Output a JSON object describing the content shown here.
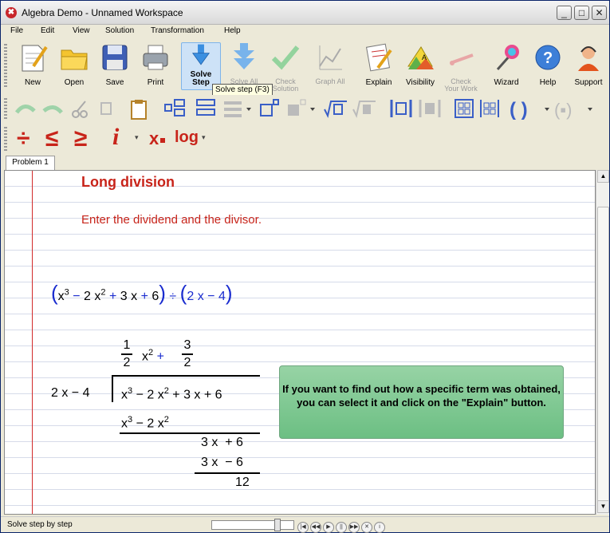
{
  "window": {
    "title": "Algebra Demo - Unnamed Workspace",
    "controls": {
      "minimize": "_",
      "maximize": "□",
      "close": "✕"
    }
  },
  "menu": [
    "File",
    "Edit",
    "View",
    "Solution",
    "Transformation",
    "Help"
  ],
  "toolbar_main": [
    {
      "label": "New",
      "icon": "new-document-icon"
    },
    {
      "label": "Open",
      "icon": "folder-icon"
    },
    {
      "label": "Save",
      "icon": "floppy-icon"
    },
    {
      "label": "Print",
      "icon": "printer-icon"
    },
    {
      "label": "Solve Step",
      "icon": "down-arrow-icon"
    },
    {
      "label": "Solve All",
      "icon": "double-down-arrow-icon"
    },
    {
      "label": "Check Solution",
      "icon": "checkmark-icon"
    },
    {
      "label": "Graph All",
      "icon": "graph-icon"
    },
    {
      "label": "Explain",
      "icon": "explain-icon"
    },
    {
      "label": "Visibility",
      "icon": "visibility-icon"
    },
    {
      "label": "Check Your Work",
      "icon": "check-work-icon"
    },
    {
      "label": "Wizard",
      "icon": "wand-icon"
    },
    {
      "label": "Help",
      "icon": "help-icon"
    },
    {
      "label": "Support",
      "icon": "support-icon"
    }
  ],
  "tooltip": "Solve step (F3)",
  "toolbar_symbols": {
    "divide": "÷",
    "le": "≤",
    "ge": "≥",
    "imag": "i",
    "subscript": "x",
    "log": "log"
  },
  "tab": "Problem 1",
  "document": {
    "heading": "Long division",
    "instruction": "Enter the dividend and the divisor.",
    "problem_terms": [
      "x",
      "3",
      "−",
      "2",
      "x",
      "2",
      "+",
      "3",
      "x",
      "+",
      "6",
      "÷",
      "2",
      "x",
      "−",
      "4"
    ],
    "quotient": {
      "num1": "1",
      "den1": "2",
      "x": "x",
      "exp": "2",
      "plus": "+",
      "num2": "3",
      "den2": "2"
    },
    "divisor": "2 x − 4",
    "dividend": {
      "x": "x",
      "e3": "3",
      "t2": "− 2 x",
      "e2": "2",
      "t3": "+ 3 x",
      "t4": "+ 6"
    },
    "sub1": {
      "x": "x",
      "e3": "3",
      "t2": "− 2 x",
      "e2": "2"
    },
    "rem1": {
      "a": "3 x",
      "b": "+ 6"
    },
    "sub2": {
      "a": "3 x",
      "b": "− 6"
    },
    "result": "12",
    "callout": "If you want to find out how a specific term was obtained, you can select it and click on the \"Explain\" button."
  },
  "status": "Solve step by step",
  "colors": {
    "heading": "#c8241a",
    "accent_blue": "#1a2ccf",
    "callout": "#7dc690"
  }
}
